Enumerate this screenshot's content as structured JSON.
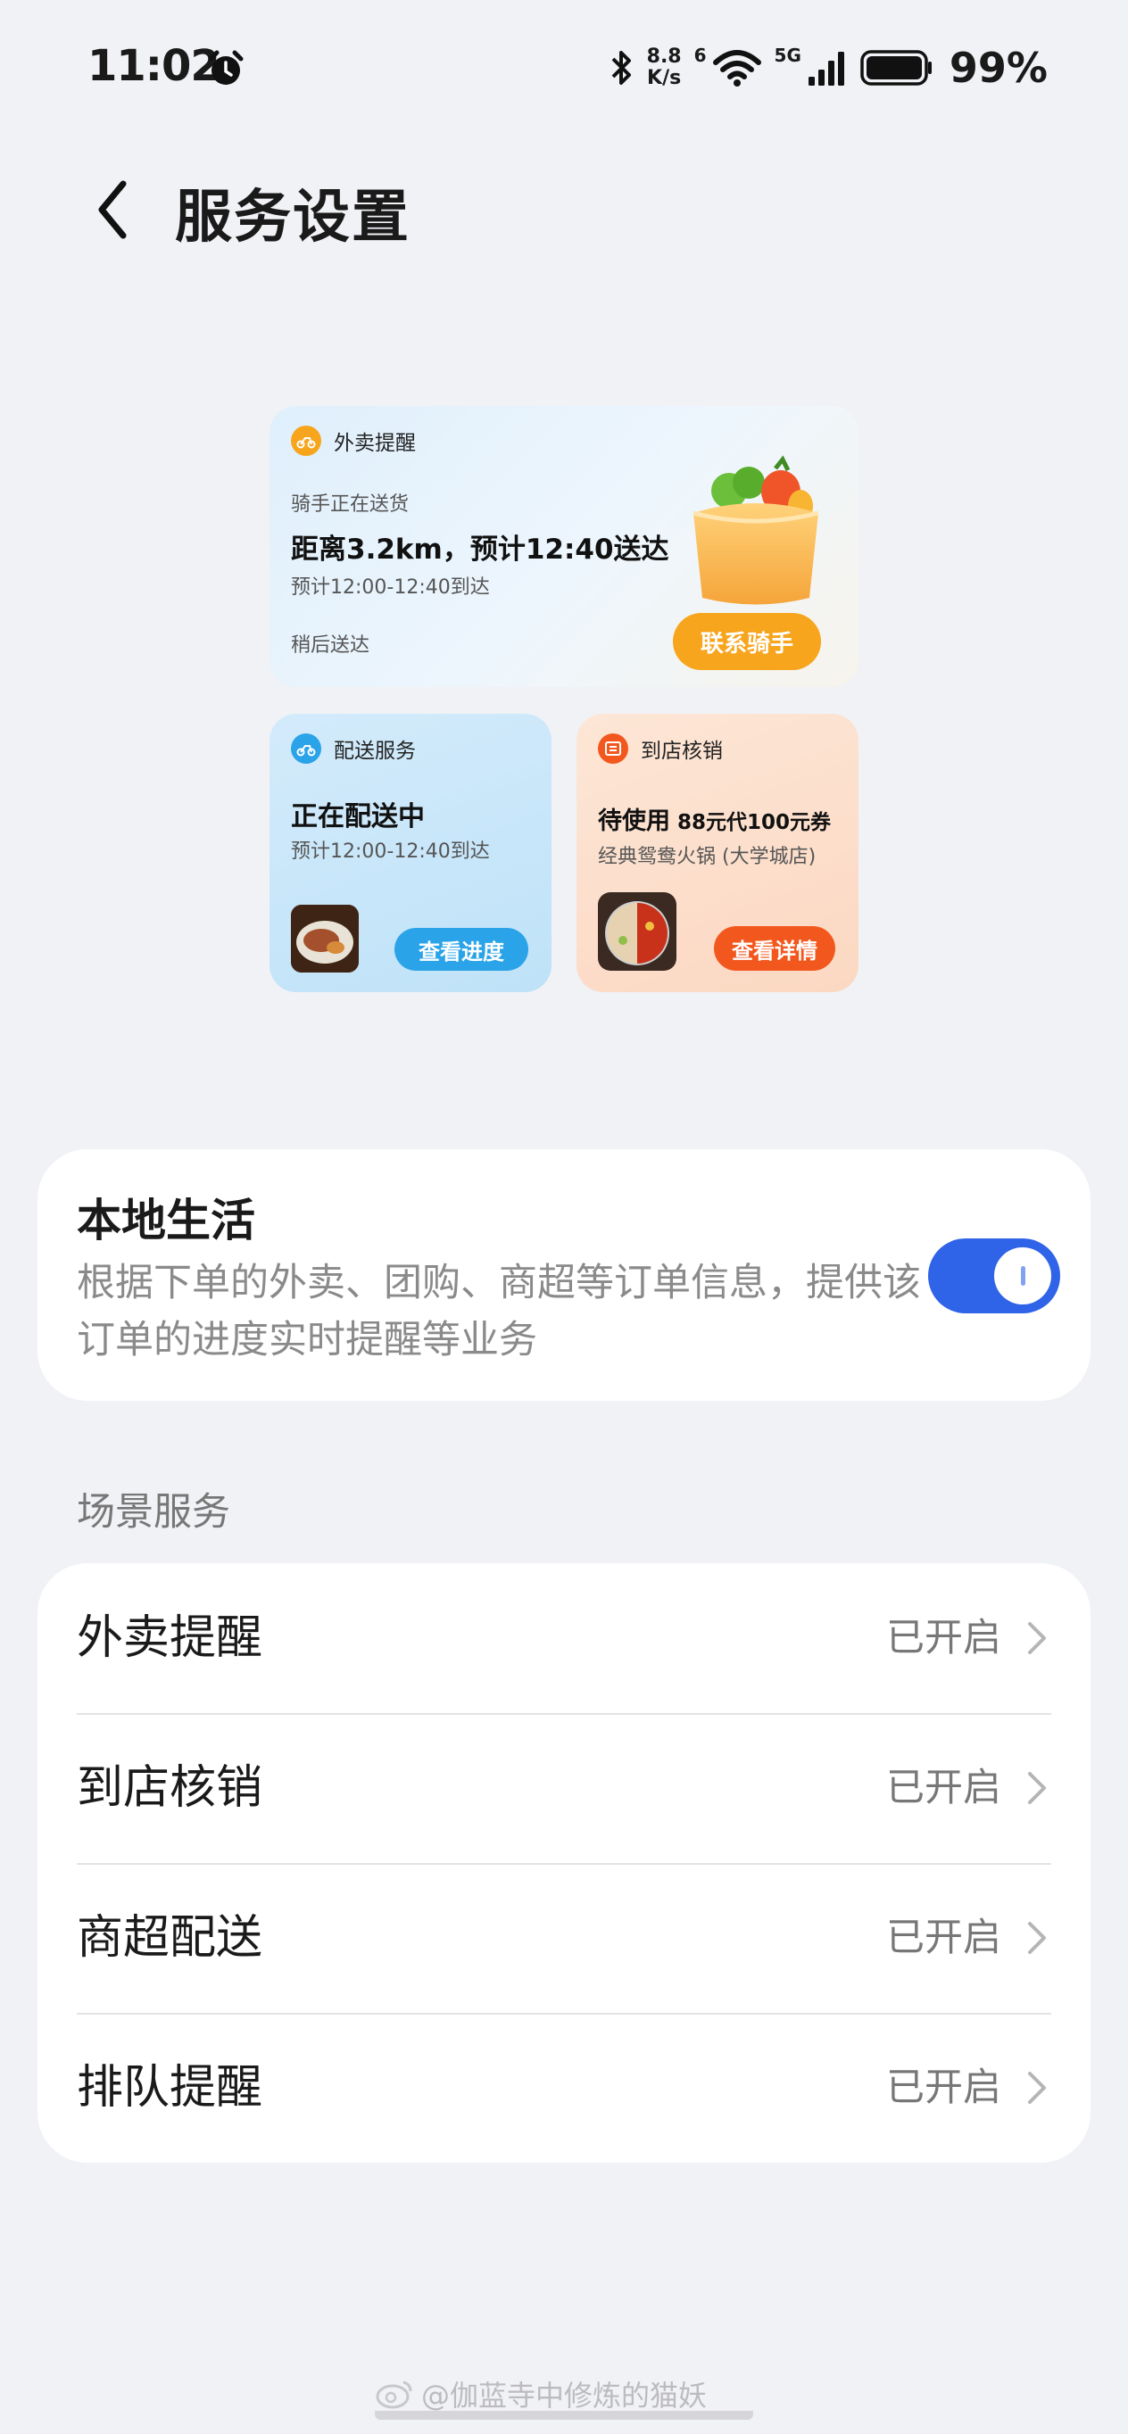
{
  "status_bar": {
    "time": "11:02",
    "net_speed_value": "8.8",
    "net_speed_unit": "K/s",
    "wifi_label": "6",
    "cell_label": "5G",
    "battery": "99%"
  },
  "header": {
    "title": "服务设置"
  },
  "preview": {
    "takeout": {
      "title": "外卖提醒",
      "status": "骑手正在送货",
      "headline": "距离3.2km，预计12:40送达",
      "eta": "预计12:00-12:40到达",
      "footer": "稍后送达",
      "button": "联系骑手"
    },
    "delivery": {
      "title": "配送服务",
      "headline": "正在配送中",
      "eta": "预计12:00-12:40到达",
      "button": "查看进度"
    },
    "instore": {
      "title": "到店核销",
      "headline_prefix": "待使用",
      "headline_coupon": "88元代100元券",
      "shop": "经典鸳鸯火锅 (大学城店)",
      "button": "查看详情"
    }
  },
  "local_life": {
    "title": "本地生活",
    "description": "根据下单的外卖、团购、商超等订单信息，提供该订单的进度实时提醒等业务",
    "enabled": true
  },
  "scene_services": {
    "label": "场景服务",
    "items": [
      {
        "label": "外卖提醒",
        "status": "已开启"
      },
      {
        "label": "到店核销",
        "status": "已开启"
      },
      {
        "label": "商超配送",
        "status": "已开启"
      },
      {
        "label": "排队提醒",
        "status": "已开启"
      }
    ]
  },
  "watermark": "@伽蓝寺中修炼的猫妖",
  "colors": {
    "background": "#f1f2f6",
    "toggle_on": "#2f63e8",
    "takeout_accent": "#f7a51c",
    "delivery_accent": "#2aa3e8",
    "instore_accent": "#f2581e"
  }
}
